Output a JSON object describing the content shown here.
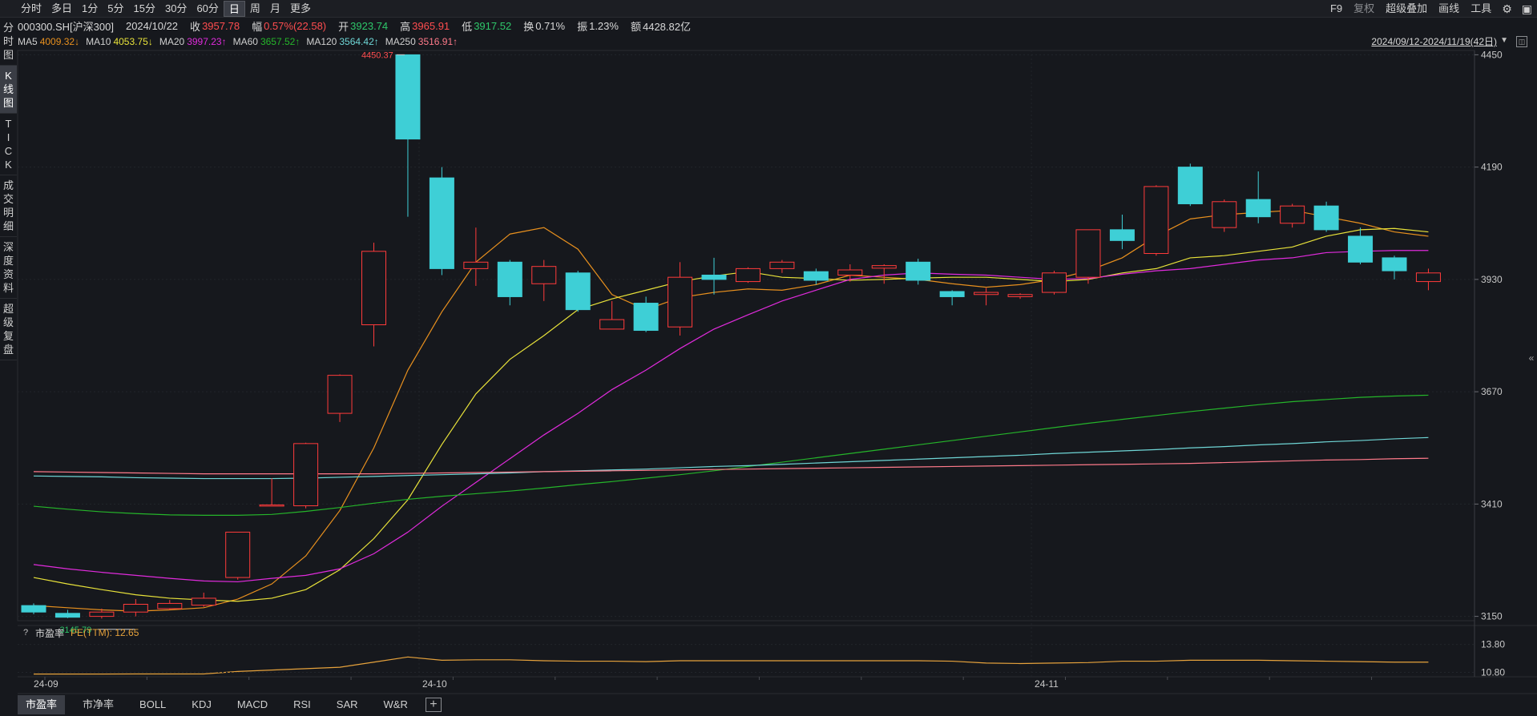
{
  "toolbar": {
    "period_tabs": [
      "分时",
      "多日",
      "1分",
      "5分",
      "15分",
      "30分",
      "60分",
      "日",
      "周",
      "月",
      "更多"
    ],
    "active_period": "日",
    "right_tools": {
      "f9": "F9",
      "fuquan": "复权",
      "overlay": "超级叠加",
      "draw": "画线",
      "tools": "工具"
    }
  },
  "info": {
    "code": "000300.SH[沪深300]",
    "date": "2024/10/22",
    "close_label": "收",
    "close": "3957.78",
    "change_label": "幅",
    "change": "0.57%(22.58)",
    "open_label": "开",
    "open": "3923.74",
    "high_label": "高",
    "high": "3965.91",
    "low_label": "低",
    "low": "3917.52",
    "turnover_label": "换",
    "turnover": "0.71%",
    "amplitude_label": "振",
    "amplitude": "1.23%",
    "amount_label": "额",
    "amount": "4428.82亿"
  },
  "ma": [
    {
      "label": "MA5",
      "value": "4009.32↓",
      "color": "#e8901e"
    },
    {
      "label": "MA10",
      "value": "4053.75↓",
      "color": "#e8e23a"
    },
    {
      "label": "MA20",
      "value": "3997.23↑",
      "color": "#e02bdc"
    },
    {
      "label": "MA60",
      "value": "3657.52↑",
      "color": "#25b52a"
    },
    {
      "label": "MA120",
      "value": "3564.42↑",
      "color": "#6fd6d6"
    },
    {
      "label": "MA250",
      "value": "3516.91↑",
      "color": "#ff7a8a"
    }
  ],
  "date_range": "2024/09/12-2024/11/19(42日)",
  "left_tabs": [
    {
      "label": "分时图",
      "active": false
    },
    {
      "label": "K线图",
      "active": true
    },
    {
      "label": "TICK",
      "active": false
    },
    {
      "label": "成交明细",
      "active": false
    },
    {
      "label": "深度资料",
      "active": false
    },
    {
      "label": "超级复盘",
      "active": false
    }
  ],
  "indicator": {
    "help": "?",
    "name": "市盈率",
    "value": "PE(TTM): 12.65"
  },
  "bottom_tabs": [
    {
      "label": "市盈率",
      "active": true
    },
    {
      "label": "市净率",
      "active": false
    },
    {
      "label": "BOLL",
      "active": false
    },
    {
      "label": "KDJ",
      "active": false
    },
    {
      "label": "MACD",
      "active": false
    },
    {
      "label": "RSI",
      "active": false
    },
    {
      "label": "SAR",
      "active": false
    },
    {
      "label": "W&R",
      "active": false
    }
  ],
  "icons": {
    "settings": "gear-icon",
    "add": "plus-icon",
    "collapse": "double-chevron-left-icon"
  },
  "chart_data": {
    "type": "candlestick",
    "y_ticks": [
      4450,
      4190,
      3930,
      3670,
      3410,
      3150
    ],
    "ylim": [
      3140,
      4460
    ],
    "pe_ticks": [
      "13.80",
      "10.80"
    ],
    "pe_ylim": [
      10.5,
      14.2
    ],
    "x_labels": [
      {
        "index": 0,
        "label": "24-09"
      },
      {
        "index": 11,
        "label": "24-10"
      },
      {
        "index": 29,
        "label": "24-11"
      }
    ],
    "max_label": {
      "index": 11,
      "value": "4450.37"
    },
    "min_label": {
      "index": 1,
      "value": "3145.79"
    },
    "candles": [
      {
        "o": 3175,
        "c": 3160,
        "h": 3180,
        "l": 3155
      },
      {
        "o": 3157,
        "c": 3148,
        "h": 3165,
        "l": 3146
      },
      {
        "o": 3150,
        "c": 3160,
        "h": 3168,
        "l": 3145
      },
      {
        "o": 3160,
        "c": 3178,
        "h": 3190,
        "l": 3150
      },
      {
        "o": 3168,
        "c": 3180,
        "h": 3188,
        "l": 3165
      },
      {
        "o": 3176,
        "c": 3192,
        "h": 3205,
        "l": 3172
      },
      {
        "o": 3240,
        "c": 3345,
        "h": 3345,
        "l": 3235
      },
      {
        "o": 3408,
        "c": 3408,
        "h": 3470,
        "l": 3405
      },
      {
        "o": 3406,
        "c": 3550,
        "h": 3552,
        "l": 3400
      },
      {
        "o": 3620,
        "c": 3708,
        "h": 3710,
        "l": 3600
      },
      {
        "o": 3825,
        "c": 3995,
        "h": 4015,
        "l": 3775
      },
      {
        "o": 4450,
        "c": 4255,
        "h": 4450,
        "l": 4075
      },
      {
        "o": 4165,
        "c": 3955,
        "h": 4190,
        "l": 3940
      },
      {
        "o": 3955,
        "c": 3970,
        "h": 4050,
        "l": 3915
      },
      {
        "o": 3970,
        "c": 3890,
        "h": 3975,
        "l": 3870
      },
      {
        "o": 3920,
        "c": 3960,
        "h": 3975,
        "l": 3880
      },
      {
        "o": 3945,
        "c": 3860,
        "h": 3950,
        "l": 3855
      },
      {
        "o": 3815,
        "c": 3837,
        "h": 3880,
        "l": 3815
      },
      {
        "o": 3875,
        "c": 3812,
        "h": 3890,
        "l": 3808
      },
      {
        "o": 3820,
        "c": 3935,
        "h": 3970,
        "l": 3800
      },
      {
        "o": 3940,
        "c": 3930,
        "h": 3980,
        "l": 3895
      },
      {
        "o": 3925,
        "c": 3955,
        "h": 3958,
        "l": 3922
      },
      {
        "o": 3955,
        "c": 3970,
        "h": 3975,
        "l": 3945
      },
      {
        "o": 3948,
        "c": 3928,
        "h": 3955,
        "l": 3918
      },
      {
        "o": 3940,
        "c": 3952,
        "h": 3965,
        "l": 3925
      },
      {
        "o": 3956,
        "c": 3962,
        "h": 3965,
        "l": 3920
      },
      {
        "o": 3970,
        "c": 3928,
        "h": 3978,
        "l": 3918
      },
      {
        "o": 3902,
        "c": 3890,
        "h": 3905,
        "l": 3870
      },
      {
        "o": 3895,
        "c": 3900,
        "h": 3910,
        "l": 3870
      },
      {
        "o": 3890,
        "c": 3895,
        "h": 3898,
        "l": 3885
      },
      {
        "o": 3900,
        "c": 3945,
        "h": 3950,
        "l": 3895
      },
      {
        "o": 3935,
        "c": 4045,
        "h": 4045,
        "l": 3920
      },
      {
        "o": 4045,
        "c": 4020,
        "h": 4080,
        "l": 4000
      },
      {
        "o": 3990,
        "c": 4145,
        "h": 4148,
        "l": 3985
      },
      {
        "o": 4190,
        "c": 4105,
        "h": 4198,
        "l": 4100
      },
      {
        "o": 4050,
        "c": 4110,
        "h": 4115,
        "l": 4040
      },
      {
        "o": 4115,
        "c": 4075,
        "h": 4180,
        "l": 4060
      },
      {
        "o": 4060,
        "c": 4100,
        "h": 4105,
        "l": 4050
      },
      {
        "o": 4100,
        "c": 4045,
        "h": 4110,
        "l": 4040
      },
      {
        "o": 4030,
        "c": 3970,
        "h": 4050,
        "l": 3965
      },
      {
        "o": 3980,
        "c": 3950,
        "h": 3985,
        "l": 3930
      },
      {
        "o": 3925,
        "c": 3945,
        "h": 3955,
        "l": 3905
      }
    ],
    "series": [
      {
        "name": "MA5",
        "color": "#e8901e",
        "values": [
          3175,
          3170,
          3165,
          3162,
          3165,
          3170,
          3190,
          3225,
          3290,
          3395,
          3540,
          3720,
          3855,
          3970,
          4035,
          4050,
          4000,
          3895,
          3860,
          3888,
          3900,
          3908,
          3905,
          3918,
          3940,
          3935,
          3930,
          3920,
          3912,
          3918,
          3930,
          3950,
          3980,
          4030,
          4070,
          4080,
          4085,
          4090,
          4075,
          4060,
          4040,
          4030
        ]
      },
      {
        "name": "MA10",
        "color": "#e8e23a",
        "values": [
          3240,
          3225,
          3212,
          3200,
          3192,
          3188,
          3185,
          3192,
          3212,
          3258,
          3330,
          3420,
          3548,
          3665,
          3745,
          3800,
          3860,
          3885,
          3905,
          3925,
          3938,
          3948,
          3935,
          3932,
          3928,
          3930,
          3933,
          3935,
          3935,
          3930,
          3925,
          3930,
          3945,
          3955,
          3980,
          3985,
          3995,
          4005,
          4030,
          4045,
          4048,
          4040
        ]
      },
      {
        "name": "MA20",
        "color": "#e02bdc",
        "values": [
          3270,
          3260,
          3252,
          3245,
          3238,
          3232,
          3230,
          3238,
          3245,
          3260,
          3295,
          3345,
          3405,
          3460,
          3515,
          3570,
          3620,
          3675,
          3720,
          3770,
          3815,
          3848,
          3880,
          3905,
          3930,
          3940,
          3945,
          3942,
          3940,
          3935,
          3930,
          3932,
          3942,
          3950,
          3955,
          3965,
          3975,
          3980,
          3992,
          3995,
          3997,
          3997
        ]
      },
      {
        "name": "MA60",
        "color": "#25b52a",
        "values": [
          3405,
          3398,
          3392,
          3388,
          3385,
          3384,
          3384,
          3386,
          3393,
          3402,
          3412,
          3421,
          3428,
          3434,
          3440,
          3447,
          3455,
          3462,
          3470,
          3478,
          3487,
          3497,
          3507,
          3517,
          3527,
          3537,
          3547,
          3557,
          3567,
          3577,
          3587,
          3597,
          3606,
          3615,
          3624,
          3632,
          3640,
          3647,
          3652,
          3657,
          3660,
          3662
        ]
      },
      {
        "name": "MA120",
        "color": "#6fd6d6",
        "values": [
          3475,
          3474,
          3473,
          3471,
          3470,
          3469,
          3469,
          3469,
          3470,
          3472,
          3474,
          3476,
          3478,
          3480,
          3482,
          3485,
          3487,
          3489,
          3491,
          3494,
          3497,
          3499,
          3502,
          3505,
          3508,
          3511,
          3514,
          3517,
          3520,
          3523,
          3527,
          3530,
          3533,
          3536,
          3540,
          3543,
          3547,
          3550,
          3554,
          3557,
          3561,
          3564
        ]
      },
      {
        "name": "MA250",
        "color": "#ff7a8a",
        "values": [
          3485,
          3484,
          3483,
          3482,
          3481,
          3480,
          3480,
          3480,
          3480,
          3480,
          3480,
          3481,
          3482,
          3483,
          3484,
          3485,
          3486,
          3487,
          3488,
          3489,
          3490,
          3491,
          3492,
          3493,
          3494,
          3495,
          3496,
          3497,
          3498,
          3499,
          3500,
          3501,
          3502,
          3503,
          3504,
          3506,
          3508,
          3510,
          3512,
          3513,
          3515,
          3516
        ]
      },
      {
        "name": "PE(TTM)",
        "color": "#e6a23c",
        "values": [
          10.62,
          10.62,
          10.62,
          10.63,
          10.63,
          10.63,
          10.9,
          11.05,
          11.2,
          11.35,
          11.9,
          12.45,
          12.1,
          12.15,
          12.15,
          12.05,
          12.0,
          12.0,
          11.95,
          12.05,
          12.05,
          12.05,
          12.05,
          12.05,
          12.05,
          12.05,
          12.05,
          12.0,
          11.8,
          11.75,
          11.8,
          11.85,
          12.0,
          12.0,
          12.1,
          12.1,
          12.1,
          12.05,
          12.0,
          11.95,
          11.9,
          11.9
        ]
      }
    ]
  }
}
